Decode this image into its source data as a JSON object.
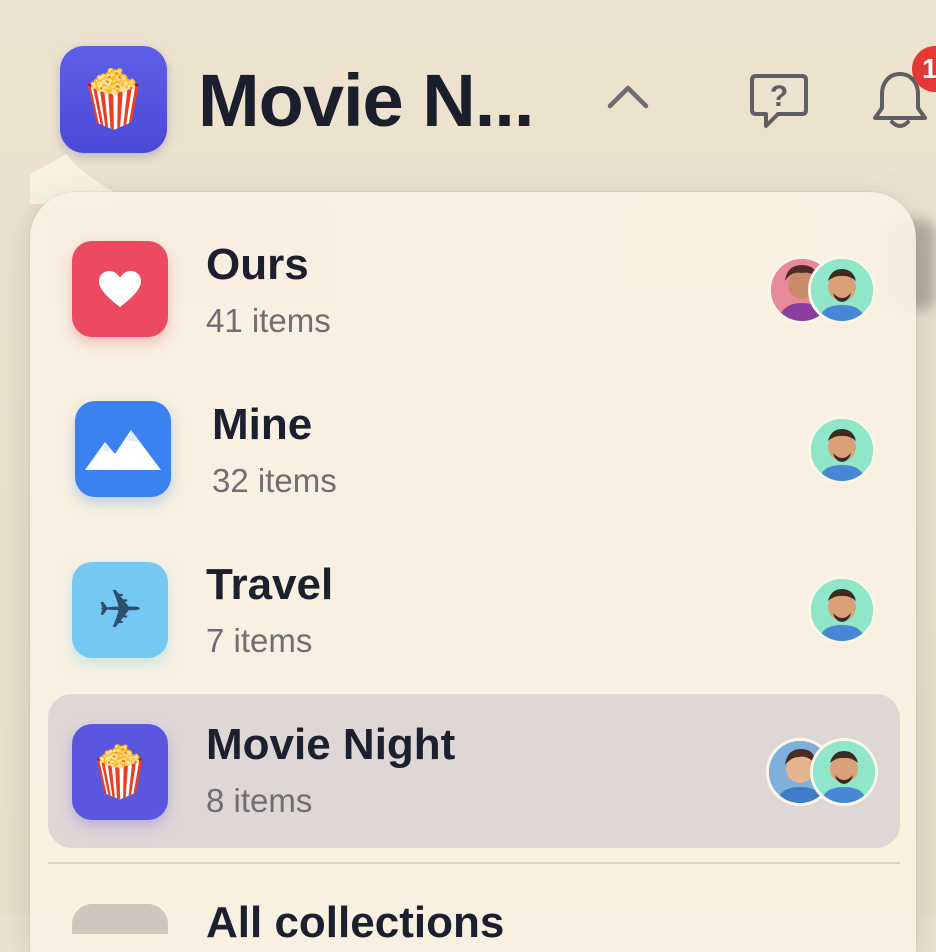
{
  "header": {
    "title": "Movie N...",
    "icon": "popcorn-icon",
    "notification_count": "1"
  },
  "colors": {
    "ours": "#ec4a63",
    "mine": "#3b82f0",
    "travel": "#74c8f2",
    "movie_night": "#5a56e0",
    "badge": "#e53935"
  },
  "lists": [
    {
      "title": "Ours",
      "subtitle": "41 items",
      "icon": "heart-icon"
    },
    {
      "title": "Mine",
      "subtitle": "32 items",
      "icon": "mountains-icon"
    },
    {
      "title": "Travel",
      "subtitle": "7 items",
      "icon": "airplane-icon"
    },
    {
      "title": "Movie Night",
      "subtitle": "8 items",
      "icon": "popcorn-icon"
    }
  ],
  "peek": {
    "title": "All collections"
  }
}
